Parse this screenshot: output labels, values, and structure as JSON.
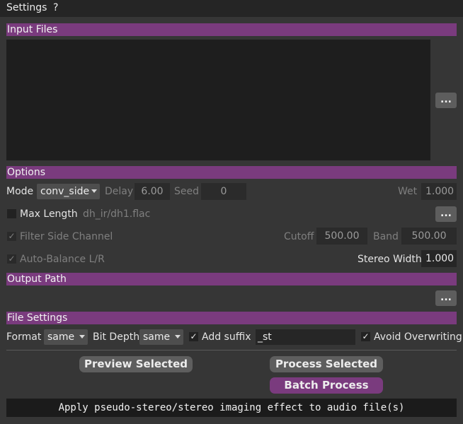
{
  "menu": {
    "settings": "Settings",
    "help": "?"
  },
  "sections": {
    "input_files": "Input Files",
    "options": "Options",
    "output_path": "Output Path",
    "file_settings": "File Settings"
  },
  "browse_label": "...",
  "options": {
    "mode_label": "Mode",
    "mode_value": "conv_side",
    "delay_label": "Delay",
    "delay_value": "6.00",
    "seed_label": "Seed",
    "seed_value": "0",
    "wet_label": "Wet",
    "wet_value": "1.000",
    "max_length_label": "Max Length",
    "ir_path": "dh_ir/dh1.flac",
    "filter_side_label": "Filter Side Channel",
    "cutoff_label": "Cutoff",
    "cutoff_value": "500.00",
    "band_label": "Band",
    "band_value": "500.00",
    "auto_balance_label": "Auto-Balance L/R",
    "stereo_width_label": "Stereo Width",
    "stereo_width_value": "1.000"
  },
  "file_settings": {
    "format_label": "Format",
    "format_value": "same",
    "bit_depth_label": "Bit Depth",
    "bit_depth_value": "same",
    "add_suffix_label": "Add suffix",
    "suffix_value": "_st",
    "avoid_overwriting_label": "Avoid Overwriting",
    "check_mark": "✓"
  },
  "buttons": {
    "preview_selected": "Preview Selected",
    "process_selected": "Process Selected",
    "batch_process": "Batch Process"
  },
  "status": "Apply pseudo-stereo/stereo imaging effect to audio file(s)",
  "colors": {
    "accent": "#7a3b7e",
    "background": "#363636",
    "field": "#262626"
  }
}
